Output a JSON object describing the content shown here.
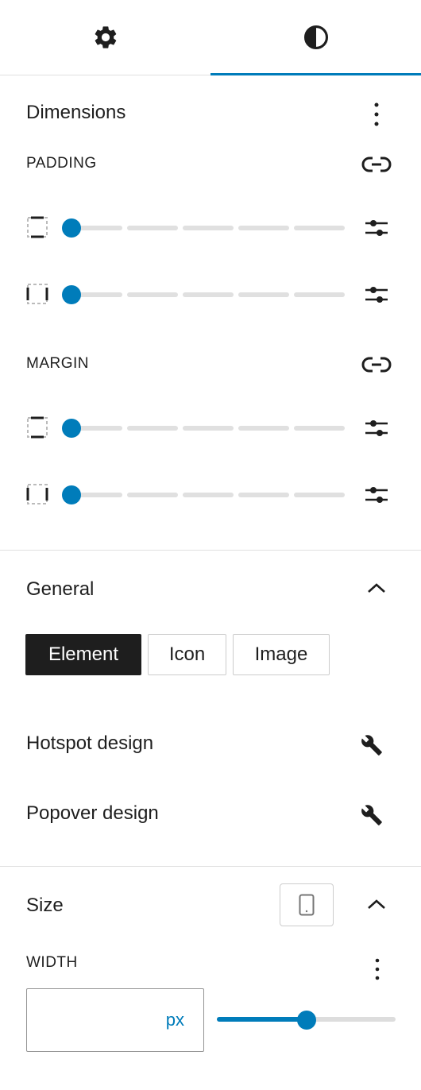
{
  "tabs": [
    {
      "name": "settings-tab",
      "icon": "gear-icon"
    },
    {
      "name": "styles-tab",
      "icon": "half-circle-icon",
      "active": true
    }
  ],
  "dimensions": {
    "title": "Dimensions",
    "padding_label": "PADDING",
    "margin_label": "MARGIN",
    "padding_rows": [
      {
        "side": "vertical",
        "value_fraction": 0
      },
      {
        "side": "horizontal",
        "value_fraction": 0
      }
    ],
    "margin_rows": [
      {
        "side": "vertical",
        "value_fraction": 0
      },
      {
        "side": "horizontal",
        "value_fraction": 0
      }
    ]
  },
  "general": {
    "title": "General",
    "options": [
      "Element",
      "Icon",
      "Image"
    ],
    "selected": "Element",
    "hotspot_label": "Hotspot design",
    "popover_label": "Popover design"
  },
  "size": {
    "title": "Size",
    "width_label": "WIDTH",
    "width_value": "",
    "width_unit": "px",
    "width_slider_fraction": 0.5
  },
  "colors": {
    "accent": "#007cba",
    "text": "#1e1e1e",
    "border": "#e0e0e0"
  }
}
